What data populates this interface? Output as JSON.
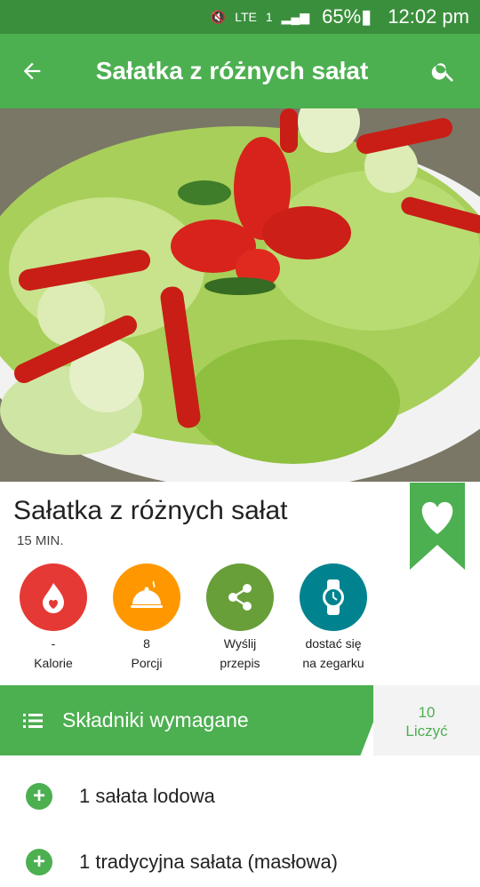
{
  "status": {
    "battery": "65%",
    "time": "12:02 pm",
    "network": "LTE",
    "sim": "1"
  },
  "appbar": {
    "title": "Sałatka z różnych sałat"
  },
  "recipe": {
    "title": "Sałatka z różnych sałat",
    "time": "15 MIN."
  },
  "actions": [
    {
      "value": "-",
      "label": "Kalorie",
      "color": "#e53935"
    },
    {
      "value": "8",
      "label": "Porcji",
      "color": "#ff9800"
    },
    {
      "value": "Wyślij",
      "label": "przepis",
      "color": "#689f38"
    },
    {
      "value": "dostać się",
      "label": "na zegarku",
      "color": "#00838f"
    }
  ],
  "section": {
    "label": "Składniki wymagane",
    "count": "10",
    "count_label": "Liczyć"
  },
  "ingredients": [
    "1 sałata lodowa",
    "1 tradycyjna sałata (masłowa)"
  ],
  "colors": {
    "primary": "#4caf50",
    "primary_dark": "#3a8f3c"
  }
}
